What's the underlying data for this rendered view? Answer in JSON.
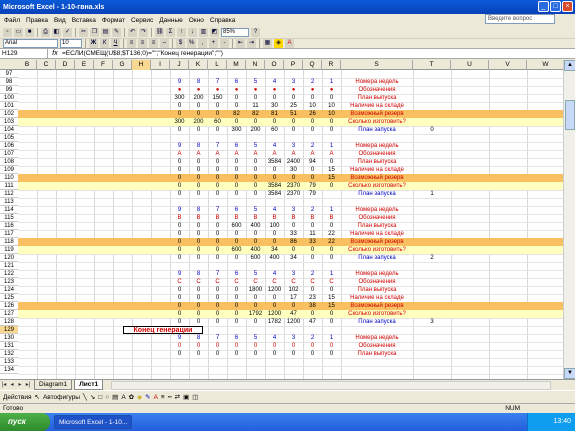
{
  "app": {
    "title": "Microsoft Excel - 1-10-гвна.xls",
    "help_placeholder": "Введите вопрос"
  },
  "menu": [
    "Файл",
    "Правка",
    "Вид",
    "Вставка",
    "Формат",
    "Сервис",
    "Данные",
    "Окно",
    "Справка"
  ],
  "toolbar": {
    "zoom": "85%",
    "font_name": "Arial",
    "font_size": "10"
  },
  "formula_bar": {
    "name_box": "H129",
    "fx": "fx",
    "formula": "=ЕСЛИ(СМЕЩ(U$8;$T136;0)=\"\";\"Конец генерации\";\"\")"
  },
  "columns": [
    "B",
    "C",
    "D",
    "E",
    "F",
    "G",
    "H",
    "I",
    "J",
    "K",
    "L",
    "M",
    "N",
    "O",
    "P",
    "Q",
    "R",
    "S",
    "T",
    "U",
    "V",
    "W"
  ],
  "row_numbers": [
    "97",
    "98",
    "99",
    "100",
    "101",
    "102",
    "103",
    "104",
    "105",
    "106",
    "107",
    "108",
    "109",
    "110",
    "111",
    "112",
    "113",
    "114",
    "115",
    "116",
    "117",
    "118",
    "119",
    "120",
    "121",
    "122",
    "123",
    "124",
    "125",
    "126",
    "127",
    "128",
    "129",
    "130",
    "131",
    "132",
    "133",
    "134"
  ],
  "rows": [
    {
      "n": "97",
      "style": "",
      "v": [
        "",
        "",
        "",
        "",
        "",
        "",
        "",
        "",
        "",
        ""
      ],
      "label": "",
      "extra": ""
    },
    {
      "n": "98",
      "style": "",
      "v": [
        "9",
        "8",
        "7",
        "6",
        "5",
        "4",
        "3",
        "2",
        "1",
        ""
      ],
      "label": "Номера недель",
      "extra": "",
      "vcolor": "blue",
      "lcolor": "red"
    },
    {
      "n": "99",
      "style": "",
      "v": [
        "●",
        "●",
        "●",
        "●",
        "●",
        "●",
        "●",
        "●",
        "●",
        ""
      ],
      "label": "Обозначения",
      "extra": "",
      "vcolor": "red",
      "lcolor": "red"
    },
    {
      "n": "100",
      "style": "",
      "v": [
        "300",
        "200",
        "150",
        "0",
        "0",
        "0",
        "0",
        "0",
        "0",
        ""
      ],
      "label": "План выпуска",
      "extra": "",
      "lcolor": "red"
    },
    {
      "n": "101",
      "style": "",
      "v": [
        "0",
        "0",
        "0",
        "0",
        "11",
        "30",
        "25",
        "10",
        "10",
        ""
      ],
      "label": "Наличие на складе",
      "extra": "",
      "lcolor": "red"
    },
    {
      "n": "102",
      "style": "orange",
      "v": [
        "0",
        "0",
        "0",
        "82",
        "82",
        "81",
        "51",
        "26",
        "10",
        ""
      ],
      "label": "Возможный резерв",
      "extra": "",
      "lcolor": "red"
    },
    {
      "n": "103",
      "style": "yellow",
      "v": [
        "300",
        "200",
        "60",
        "0",
        "0",
        "0",
        "0",
        "0",
        "0",
        ""
      ],
      "label": "Сколько изготовить?",
      "extra": "",
      "lcolor": "red"
    },
    {
      "n": "104",
      "style": "",
      "v": [
        "0",
        "0",
        "0",
        "300",
        "200",
        "60",
        "0",
        "0",
        "0",
        ""
      ],
      "label": "План запуска",
      "extra": "0",
      "lcolor": "blue"
    },
    {
      "n": "105",
      "style": "",
      "v": [
        "",
        "",
        "",
        "",
        "",
        "",
        "",
        "",
        "",
        ""
      ],
      "label": "",
      "extra": ""
    },
    {
      "n": "106",
      "style": "",
      "v": [
        "9",
        "8",
        "7",
        "6",
        "5",
        "4",
        "3",
        "2",
        "1",
        ""
      ],
      "label": "Номера недель",
      "extra": "",
      "vcolor": "blue",
      "lcolor": "red"
    },
    {
      "n": "107",
      "style": "",
      "v": [
        "A",
        "A",
        "A",
        "A",
        "A",
        "A",
        "A",
        "A",
        "A",
        ""
      ],
      "label": "Обозначения",
      "extra": "",
      "vcolor": "red",
      "lcolor": "red"
    },
    {
      "n": "108",
      "style": "",
      "v": [
        "0",
        "0",
        "0",
        "0",
        "0",
        "3584",
        "2400",
        "94",
        "0",
        ""
      ],
      "label": "План выпуска",
      "extra": "",
      "lcolor": "red"
    },
    {
      "n": "109",
      "style": "",
      "v": [
        "0",
        "0",
        "0",
        "0",
        "0",
        "0",
        "30",
        "0",
        "15",
        ""
      ],
      "label": "Наличие на складе",
      "extra": "",
      "lcolor": "red"
    },
    {
      "n": "110",
      "style": "orange",
      "v": [
        "0",
        "0",
        "0",
        "0",
        "0",
        "0",
        "0",
        "0",
        "15",
        ""
      ],
      "label": "Возможный резерв",
      "extra": "",
      "lcolor": "red"
    },
    {
      "n": "111",
      "style": "yellow",
      "v": [
        "0",
        "0",
        "0",
        "0",
        "0",
        "3584",
        "2370",
        "79",
        "0",
        ""
      ],
      "label": "Сколько изготовить?",
      "extra": "",
      "lcolor": "red"
    },
    {
      "n": "112",
      "style": "",
      "v": [
        "0",
        "0",
        "0",
        "0",
        "0",
        "3584",
        "2370",
        "79",
        "",
        ""
      ],
      "label": "План запуска",
      "extra": "1",
      "lcolor": "blue"
    },
    {
      "n": "113",
      "style": "",
      "v": [
        "",
        "",
        "",
        "",
        "",
        "",
        "",
        "",
        "",
        ""
      ],
      "label": "",
      "extra": ""
    },
    {
      "n": "114",
      "style": "",
      "v": [
        "9",
        "8",
        "7",
        "6",
        "5",
        "4",
        "3",
        "2",
        "1",
        ""
      ],
      "label": "Номера недель",
      "extra": "",
      "vcolor": "blue",
      "lcolor": "red"
    },
    {
      "n": "115",
      "style": "",
      "v": [
        "B",
        "B",
        "B",
        "B",
        "B",
        "B",
        "B",
        "B",
        "B",
        ""
      ],
      "label": "Обозначения",
      "extra": "",
      "vcolor": "red",
      "lcolor": "red"
    },
    {
      "n": "116",
      "style": "",
      "v": [
        "0",
        "0",
        "0",
        "600",
        "400",
        "100",
        "0",
        "0",
        "0",
        ""
      ],
      "label": "План выпуска",
      "extra": "",
      "lcolor": "red"
    },
    {
      "n": "117",
      "style": "",
      "v": [
        "0",
        "0",
        "0",
        "0",
        "0",
        "0",
        "33",
        "11",
        "22",
        ""
      ],
      "label": "Наличие на складе",
      "extra": "",
      "lcolor": "red"
    },
    {
      "n": "118",
      "style": "orange",
      "v": [
        "0",
        "0",
        "0",
        "0",
        "0",
        "0",
        "86",
        "33",
        "22",
        ""
      ],
      "label": "Возможный резерв",
      "extra": "",
      "lcolor": "red"
    },
    {
      "n": "119",
      "style": "yellow",
      "v": [
        "0",
        "0",
        "0",
        "600",
        "400",
        "34",
        "0",
        "0",
        "0",
        ""
      ],
      "label": "Сколько изготовить?",
      "extra": "",
      "lcolor": "red"
    },
    {
      "n": "120",
      "style": "",
      "v": [
        "0",
        "0",
        "0",
        "0",
        "600",
        "400",
        "34",
        "0",
        "0",
        ""
      ],
      "label": "План запуска",
      "extra": "2",
      "lcolor": "blue"
    },
    {
      "n": "121",
      "style": "",
      "v": [
        "",
        "",
        "",
        "",
        "",
        "",
        "",
        "",
        "",
        ""
      ],
      "label": "",
      "extra": ""
    },
    {
      "n": "122",
      "style": "",
      "v": [
        "9",
        "8",
        "7",
        "6",
        "5",
        "4",
        "3",
        "2",
        "1",
        ""
      ],
      "label": "Номера недель",
      "extra": "",
      "vcolor": "blue",
      "lcolor": "red"
    },
    {
      "n": "123",
      "style": "",
      "v": [
        "C",
        "C",
        "C",
        "C",
        "C",
        "C",
        "C",
        "C",
        "C",
        ""
      ],
      "label": "Обозначения",
      "extra": "",
      "vcolor": "red",
      "lcolor": "red"
    },
    {
      "n": "124",
      "style": "",
      "v": [
        "0",
        "0",
        "0",
        "0",
        "1800",
        "1200",
        "102",
        "0",
        "0",
        ""
      ],
      "label": "План выпуска",
      "extra": "",
      "lcolor": "red"
    },
    {
      "n": "125",
      "style": "",
      "v": [
        "0",
        "0",
        "0",
        "0",
        "0",
        "0",
        "17",
        "23",
        "15",
        ""
      ],
      "label": "Наличие на складе",
      "extra": "",
      "lcolor": "red"
    },
    {
      "n": "126",
      "style": "orange",
      "v": [
        "0",
        "0",
        "0",
        "0",
        "0",
        "0",
        "0",
        "38",
        "15",
        ""
      ],
      "label": "Возможный резерв",
      "extra": "",
      "lcolor": "red"
    },
    {
      "n": "127",
      "style": "yellow",
      "v": [
        "0",
        "0",
        "0",
        "0",
        "1792",
        "1200",
        "47",
        "0",
        "0",
        ""
      ],
      "label": "Сколько изготовить?",
      "extra": "",
      "lcolor": "red"
    },
    {
      "n": "128",
      "style": "",
      "v": [
        "0",
        "0",
        "0",
        "0",
        "0",
        "1782",
        "1200",
        "47",
        "0",
        ""
      ],
      "label": "План запуска",
      "extra": "3",
      "lcolor": "blue"
    },
    {
      "n": "129",
      "style": "",
      "v": [
        "",
        "",
        "",
        "",
        "",
        "",
        "",
        "",
        "",
        ""
      ],
      "label": "",
      "extra": "",
      "note": "Конец генерации"
    },
    {
      "n": "130",
      "style": "",
      "v": [
        "9",
        "8",
        "7",
        "6",
        "5",
        "4",
        "3",
        "2",
        "1",
        ""
      ],
      "label": "Номера недель",
      "extra": "",
      "vcolor": "blue",
      "lcolor": "red"
    },
    {
      "n": "131",
      "style": "",
      "v": [
        "0",
        "0",
        "0",
        "0",
        "0",
        "0",
        "0",
        "0",
        "0",
        ""
      ],
      "label": "Обозначения",
      "extra": "",
      "vcolor": "red",
      "lcolor": "red"
    },
    {
      "n": "132",
      "style": "",
      "v": [
        "0",
        "0",
        "0",
        "0",
        "0",
        "0",
        "0",
        "0",
        "0",
        ""
      ],
      "label": "План выпуска",
      "extra": "",
      "lcolor": "red"
    },
    {
      "n": "133",
      "style": "",
      "v": [
        "",
        "",
        "",
        "",
        "",
        "",
        "",
        "",
        "",
        ""
      ],
      "label": "",
      "extra": ""
    },
    {
      "n": "134",
      "style": "",
      "v": [
        "",
        "",
        "",
        "",
        "",
        "",
        "",
        "",
        "",
        ""
      ],
      "label": "",
      "extra": ""
    }
  ],
  "sheet_tabs": [
    "Diagram1",
    "Лист1"
  ],
  "active_tab": "Лист1",
  "draw_bar": {
    "actions": "Действия",
    "autoshapes": "Автофигуры"
  },
  "status": {
    "ready": "Готово",
    "num": "NUM"
  },
  "taskbar": {
    "start": "пуск",
    "item": "Microsoft Excel - 1-10...",
    "time": "13:40"
  },
  "colors": {
    "orange_row": "#F8C060",
    "yellow_row": "#FFFFC0",
    "label_red": "#D00000",
    "value_blue": "#0000C0"
  }
}
